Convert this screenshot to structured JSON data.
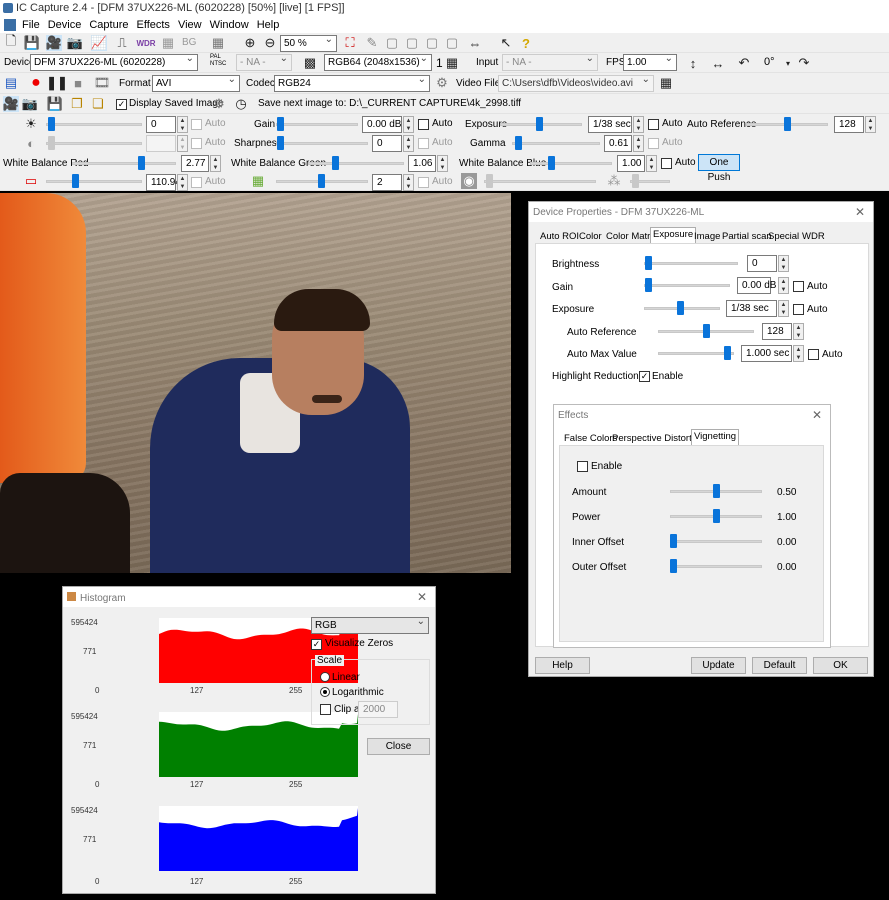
{
  "window_title": "IC Capture 2.4 - [DFM 37UX226-ML (6020228) [50%] [live] [1 FPS]]",
  "menu": [
    "File",
    "Device",
    "Capture",
    "Effects",
    "View",
    "Window",
    "Help"
  ],
  "toolbar1": {
    "bg_label": "BG",
    "zoom_value": "50 %"
  },
  "device_bar": {
    "device_label": "Device",
    "device_value": "DFM 37UX226-ML (6020228)",
    "pal_label": "PAL NTSC",
    "video_norm_value": "- NA -",
    "format_value": "RGB64 (2048x1536)",
    "count": "1",
    "input_label": "Input",
    "input_value": "- NA -",
    "fps_label": "FPS",
    "fps_value": "1.00",
    "rotate_value": "0°"
  },
  "capture_bar": {
    "format_label": "Format",
    "format_value": "AVI",
    "codec_label": "Codec",
    "codec_value": "RGB24",
    "video_file_label": "Video File",
    "video_file_value": "C:\\Users\\dfb\\Videos\\video.avi"
  },
  "image_bar": {
    "display_saved_label": "Display Saved Image",
    "save_next_label": "Save next image to: D:\\_CURRENT CAPTURE\\4k_2998.tiff"
  },
  "props": {
    "brightness_value": "0",
    "auto": "Auto",
    "gain_label": "Gain",
    "gain_value": "0.00 dB",
    "exposure_label": "Exposure",
    "exposure_value": "1/38 sec",
    "auto_ref_label": "Auto Reference",
    "auto_ref_value": "128",
    "sharpness_label": "Sharpness",
    "sharpness_value": "0",
    "gamma_label": "Gamma",
    "gamma_value": "0.61",
    "wb_red_label": "White Balance Red",
    "wb_red_value": "2.77",
    "wb_green_label": "White Balance Green",
    "wb_green_value": "1.06",
    "wb_blue_label": "White Balance Blue",
    "wb_blue_value": "1.00",
    "one_push": "One Push",
    "hue_value": "110.94",
    "sat_value": "2"
  },
  "device_props": {
    "title": "Device Properties - DFM 37UX226-ML",
    "tabs": [
      "Auto ROI",
      "Color",
      "Color Matrix",
      "Exposure",
      "Image",
      "Partial scan",
      "Special",
      "WDR"
    ],
    "brightness_label": "Brightness",
    "brightness_value": "0",
    "gain_label": "Gain",
    "gain_value": "0.00 dB",
    "exposure_label": "Exposure",
    "exposure_value": "1/38 sec",
    "auto_ref_label": "Auto Reference",
    "auto_ref_value": "128",
    "auto_max_label": "Auto Max Value",
    "auto_max_value": "1.000 sec",
    "highlight_label": "Highlight Reduction",
    "enable_label": "Enable",
    "auto": "Auto",
    "help": "Help",
    "update": "Update",
    "default": "Default",
    "ok": "OK"
  },
  "effects": {
    "title": "Effects",
    "tabs": [
      "False Colors",
      "Perspective Distortion",
      "Vignetting"
    ],
    "enable_label": "Enable",
    "rows": [
      {
        "label": "Amount",
        "value": "0.50",
        "level": 0.5
      },
      {
        "label": "Power",
        "value": "1.00",
        "level": 0.5
      },
      {
        "label": "Inner Offset",
        "value": "0.00",
        "level": 0
      },
      {
        "label": "Outer Offset",
        "value": "0.00",
        "level": 0
      }
    ]
  },
  "histogram": {
    "title": "Histogram",
    "channel_value": "RGB",
    "visualize_zeros": "Visualize Zeros",
    "scale_label": "Scale",
    "linear": "Linear",
    "logarithmic": "Logarithmic",
    "clip_label": "Clip at",
    "clip_value": "2000",
    "close": "Close",
    "y_top": "595424",
    "y_mid": "771",
    "x_ticks": [
      "0",
      "127",
      "255"
    ],
    "colors": {
      "red": "#ff0000",
      "green": "#008000",
      "blue": "#0000ff"
    }
  }
}
